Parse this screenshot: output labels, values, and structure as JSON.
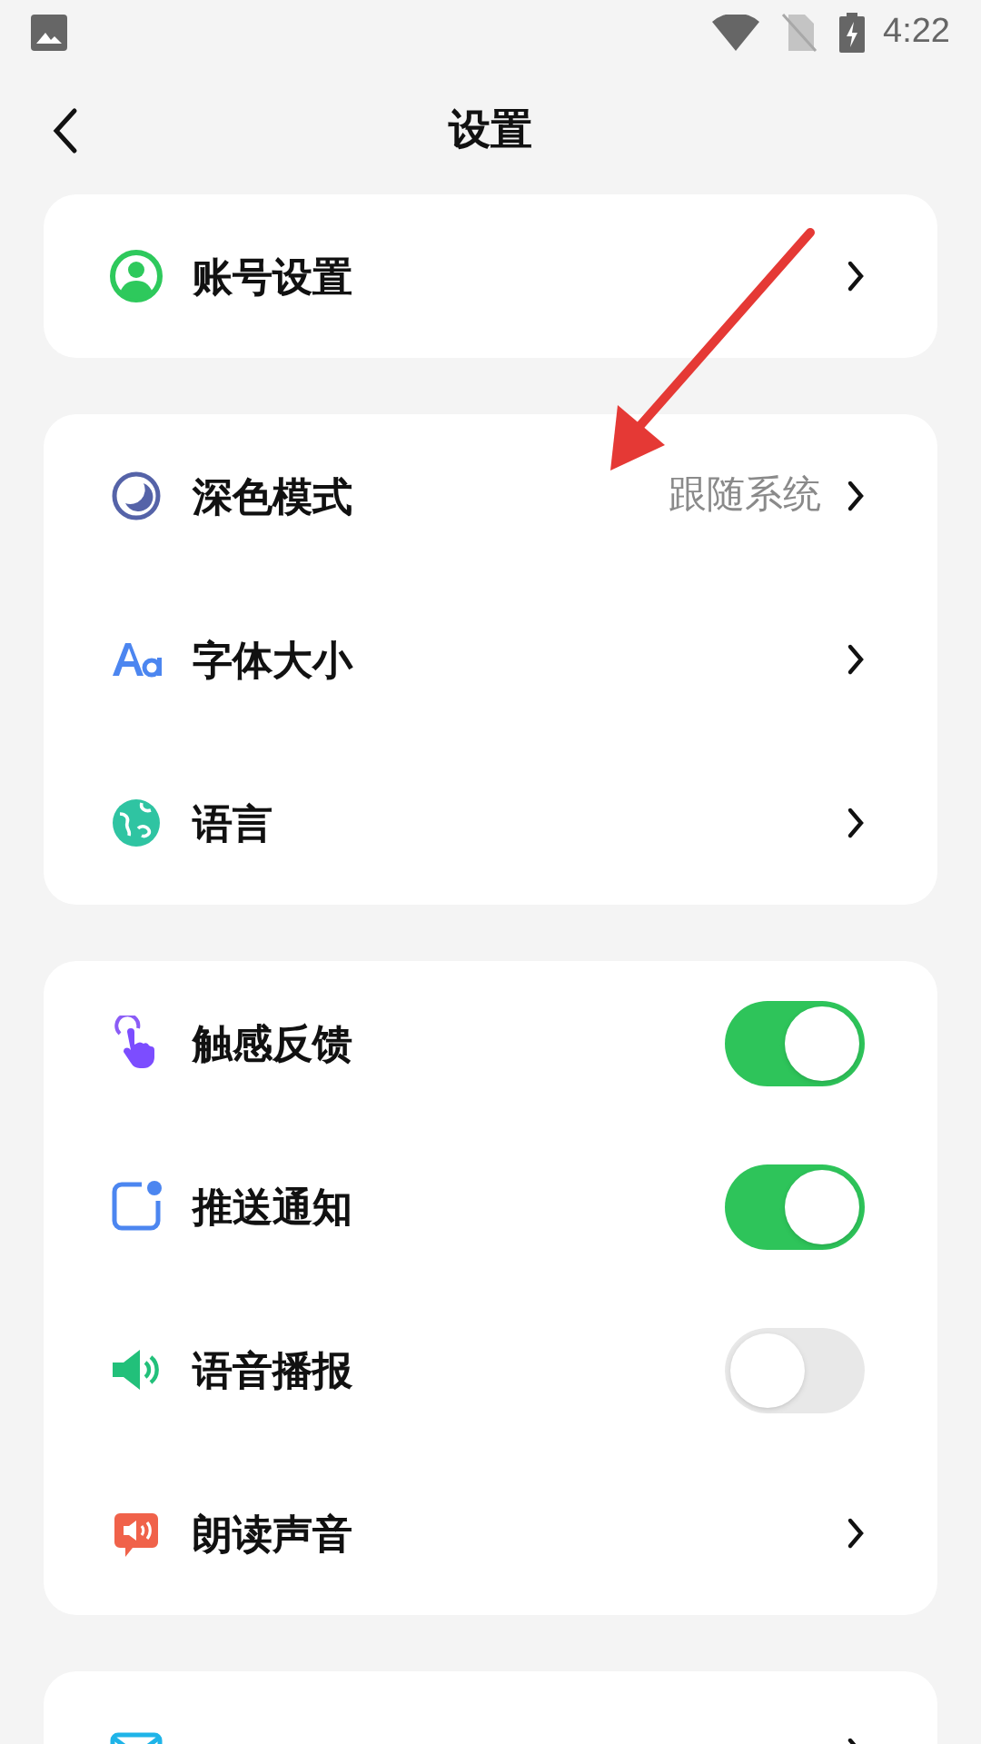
{
  "status_bar": {
    "time": "4:22"
  },
  "header": {
    "title": "设置"
  },
  "sections": [
    {
      "items": [
        {
          "kind": "link",
          "label": "账号设置"
        }
      ]
    },
    {
      "items": [
        {
          "kind": "link",
          "label": "深色模式",
          "value": "跟随系统"
        },
        {
          "kind": "link",
          "label": "字体大小"
        },
        {
          "kind": "link",
          "label": "语言"
        }
      ]
    },
    {
      "items": [
        {
          "kind": "toggle",
          "label": "触感反馈",
          "on": true
        },
        {
          "kind": "toggle",
          "label": "推送通知",
          "on": true
        },
        {
          "kind": "toggle",
          "label": "语音播报",
          "on": false
        },
        {
          "kind": "link",
          "label": "朗读声音"
        }
      ]
    },
    {
      "items": [
        {
          "kind": "link"
        }
      ]
    }
  ]
}
